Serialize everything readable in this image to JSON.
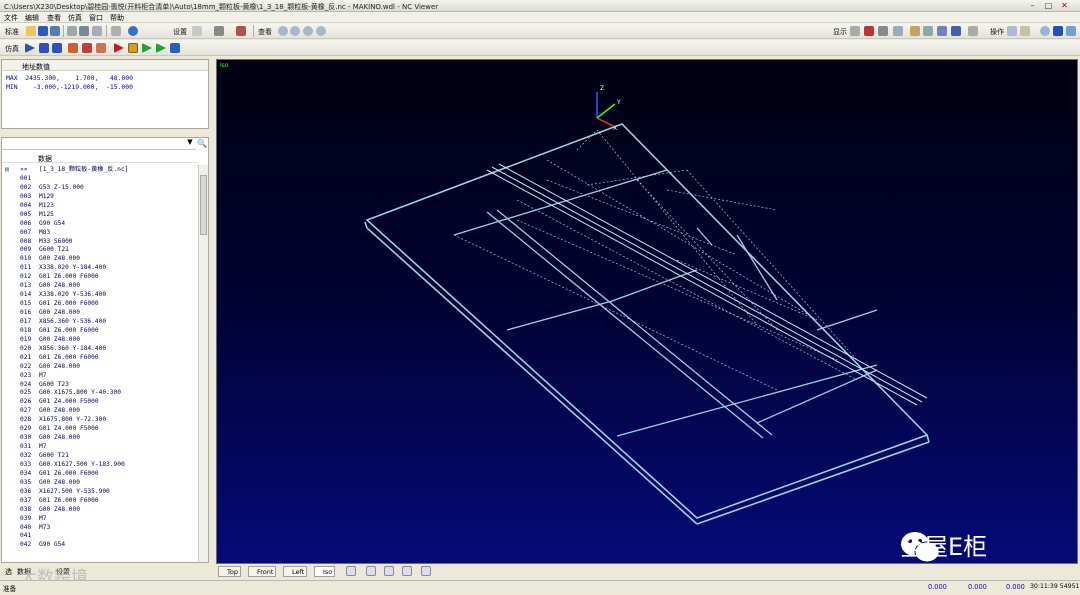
{
  "window": {
    "title": "C:\\Users\\X230\\Desktop\\碧桂园·翡悦(开料柜合清单)\\Auto\\18mm_颗粒板-黄橡\\1_3_18_颗粒板-黄橡_反.nc - MAKINO.wdl - NC Viewer"
  },
  "menu": [
    "文件",
    "编辑",
    "查看",
    "仿真",
    "窗口",
    "帮助"
  ],
  "toolbar1": {
    "standard": "标准",
    "settings": "设置",
    "view": "查看",
    "display": "显示",
    "operation": "操作"
  },
  "toolbar2": {
    "simulate": "仿真"
  },
  "address": {
    "header": "地址数值",
    "max_line": "MAX  2435.300,    1.700,   48.000",
    "min_line": "MIN    -3.000,-1219.000,  -15.000"
  },
  "code": {
    "col_header": "数据",
    "first_num": "»»",
    "first_text": "[1_3_18_颗粒板-黄橡_反.nc]",
    "lines": [
      [
        "001",
        ""
      ],
      [
        "002",
        "G53 Z-15.000"
      ],
      [
        "003",
        "M129"
      ],
      [
        "004",
        "M123"
      ],
      [
        "005",
        "M125"
      ],
      [
        "006",
        "G90 G54"
      ],
      [
        "007",
        "M83"
      ],
      [
        "008",
        "M33 S6000"
      ],
      [
        "009",
        "G600 T21"
      ],
      [
        "010",
        "G00 Z48.000"
      ],
      [
        "011",
        "X338.020 Y-184.400"
      ],
      [
        "012",
        "G01 Z6.000 F6000"
      ],
      [
        "013",
        "G00 Z48.000"
      ],
      [
        "014",
        "X338.020 Y-536.400"
      ],
      [
        "015",
        "G01 Z6.000 F6000"
      ],
      [
        "016",
        "G00 Z48.000"
      ],
      [
        "017",
        "X856.360 Y-536.400"
      ],
      [
        "018",
        "G01 Z6.000 F6000"
      ],
      [
        "019",
        "G00 Z48.000"
      ],
      [
        "020",
        "X856.360 Y-184.400"
      ],
      [
        "021",
        "G01 Z6.000 F6000"
      ],
      [
        "022",
        "G00 Z48.000"
      ],
      [
        "023",
        "M7"
      ],
      [
        "024",
        "G600 T23"
      ],
      [
        "025",
        "G00 X1675.800 Y-40.300"
      ],
      [
        "026",
        "G01 Z4.000 F5000"
      ],
      [
        "027",
        "G00 Z48.000"
      ],
      [
        "028",
        "X1675.800 Y-72.300"
      ],
      [
        "029",
        "G01 Z4.000 F5000"
      ],
      [
        "030",
        "G00 Z48.000"
      ],
      [
        "031",
        "M7"
      ],
      [
        "032",
        "G600 T21"
      ],
      [
        "033",
        "G00 X1627.500 Y-183.900"
      ],
      [
        "034",
        "G01 Z6.000 F6000"
      ],
      [
        "035",
        "G00 Z48.000"
      ],
      [
        "036",
        "X1627.500 Y-535.900"
      ],
      [
        "037",
        "G01 Z6.000 F6000"
      ],
      [
        "038",
        "G00 Z48.000"
      ],
      [
        "039",
        "M7"
      ],
      [
        "040",
        "M73"
      ],
      [
        "041",
        ""
      ],
      [
        "042",
        "G90 G54"
      ]
    ]
  },
  "panel_tabs": [
    "选",
    "数据",
    "设置"
  ],
  "viewport": {
    "mode_label": "Iso",
    "axis_x": "X",
    "axis_y": "Y",
    "axis_z": "Z"
  },
  "view_tabs": [
    "Top",
    "Front",
    "Left",
    "Iso"
  ],
  "status": {
    "left": "准备",
    "v1": "0.000",
    "v2": "0.000",
    "v3": "0.000",
    "time": "30:11:39 54951"
  },
  "watermark": {
    "brand": "全屋E柜",
    "source": "大数跨境"
  },
  "colors": {
    "viewport_bg": "#000a5a",
    "toolpath": "#9ad2e0",
    "axis_x": "#ff3030",
    "axis_y": "#30ff30",
    "axis_z": "#3060ff"
  }
}
